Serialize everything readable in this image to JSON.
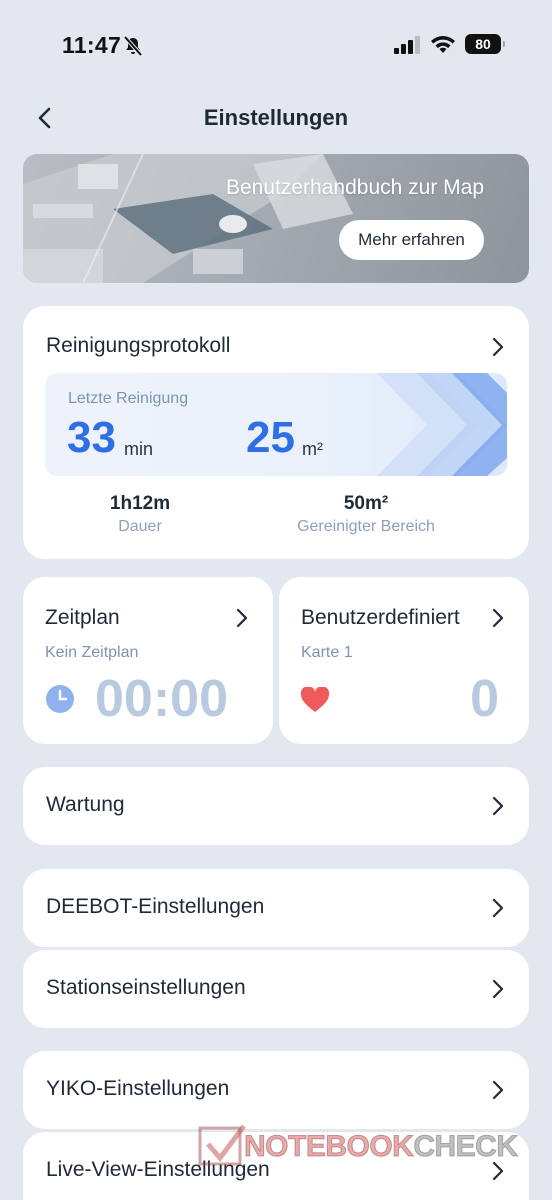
{
  "status_bar": {
    "time": "11:47",
    "battery": "80"
  },
  "nav": {
    "title": "Einstellungen"
  },
  "banner": {
    "title": "Benutzerhandbuch zur Map",
    "button_label": "Mehr erfahren"
  },
  "cleaning_log": {
    "title": "Reinigungsprotokoll",
    "last_label": "Letzte Reinigung",
    "duration_value": "33",
    "duration_unit": "min",
    "area_value": "25",
    "area_unit": "m²",
    "total_duration": "1h12m",
    "total_duration_label": "Dauer",
    "total_area": "50m²",
    "total_area_label": "Gereinigter Bereich"
  },
  "schedule": {
    "title": "Zeitplan",
    "subtitle": "Kein Zeitplan",
    "time": "00:00"
  },
  "custom": {
    "title": "Benutzerdefiniert",
    "subtitle": "Karte 1",
    "count": "0"
  },
  "menu": [
    {
      "label": "Wartung"
    },
    {
      "label": "DEEBOT-Einstellungen"
    },
    {
      "label": "Stationseinstellungen"
    },
    {
      "label": "YIKO-Einstellungen"
    },
    {
      "label": "Live-View-Einstellungen"
    }
  ],
  "watermark": {
    "text_a": "NOTEBOOK",
    "text_b": "CHECK"
  },
  "colors": {
    "accent": "#2f6fe6",
    "background": "#e3e8f0",
    "muted_number": "#b9c9e0",
    "heart": "#f05a5a"
  }
}
